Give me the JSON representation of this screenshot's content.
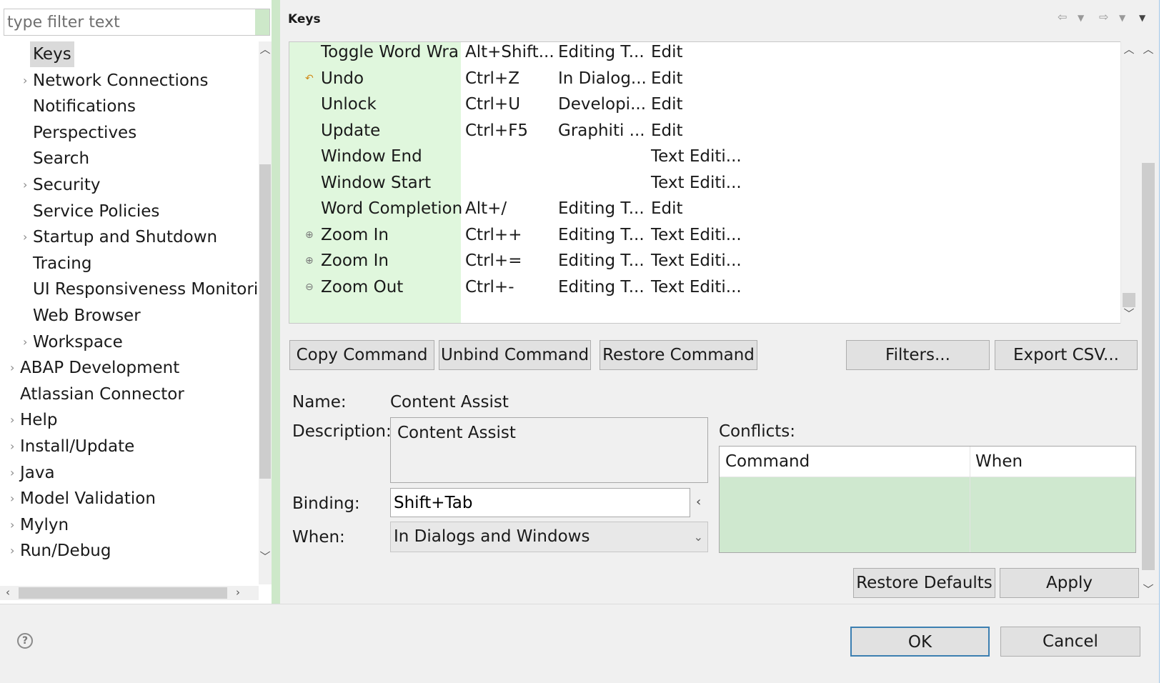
{
  "filter": {
    "placeholder": "type filter text"
  },
  "tree": {
    "items": [
      {
        "label": "Keys",
        "selected": true,
        "expandable": false
      },
      {
        "label": "Network Connections",
        "expandable": true
      },
      {
        "label": "Notifications",
        "expandable": false
      },
      {
        "label": "Perspectives",
        "expandable": false
      },
      {
        "label": "Search",
        "expandable": false
      },
      {
        "label": "Security",
        "expandable": true
      },
      {
        "label": "Service Policies",
        "expandable": false
      },
      {
        "label": "Startup and Shutdown",
        "expandable": true
      },
      {
        "label": "Tracing",
        "expandable": false
      },
      {
        "label": "UI Responsiveness Monitorir",
        "expandable": false
      },
      {
        "label": "Web Browser",
        "expandable": false
      },
      {
        "label": "Workspace",
        "expandable": true
      },
      {
        "label": "ABAP Development",
        "expandable": true
      },
      {
        "label": "Atlassian Connector",
        "expandable": false
      },
      {
        "label": "Help",
        "expandable": true
      },
      {
        "label": "Install/Update",
        "expandable": true
      },
      {
        "label": "Java",
        "expandable": true
      },
      {
        "label": "Model Validation",
        "expandable": true
      },
      {
        "label": "Mylyn",
        "expandable": true
      },
      {
        "label": "Run/Debug",
        "expandable": true
      }
    ]
  },
  "page": {
    "title": "Keys"
  },
  "bindings": {
    "rows": [
      {
        "command": "Toggle Word Wra",
        "binding": "Alt+Shift...",
        "when": "Editing T...",
        "category": "Edit",
        "icon": ""
      },
      {
        "command": "Undo",
        "binding": "Ctrl+Z",
        "when": "In Dialog...",
        "category": "Edit",
        "icon": "undo-icon"
      },
      {
        "command": "Unlock",
        "binding": "Ctrl+U",
        "when": "Developi...",
        "category": "Edit",
        "icon": ""
      },
      {
        "command": "Update",
        "binding": "Ctrl+F5",
        "when": "Graphiti ...",
        "category": "Edit",
        "icon": ""
      },
      {
        "command": "Window End",
        "binding": "",
        "when": "",
        "category": "Text Editi...",
        "icon": ""
      },
      {
        "command": "Window Start",
        "binding": "",
        "when": "",
        "category": "Text Editi...",
        "icon": ""
      },
      {
        "command": "Word Completion",
        "binding": "Alt+/",
        "when": "Editing T...",
        "category": "Edit",
        "icon": ""
      },
      {
        "command": "Zoom In",
        "binding": "Ctrl++",
        "when": "Editing T...",
        "category": "Text Editi...",
        "icon": "zoom-in-icon"
      },
      {
        "command": "Zoom In",
        "binding": "Ctrl+=",
        "when": "Editing T...",
        "category": "Text Editi...",
        "icon": "zoom-in-icon"
      },
      {
        "command": "Zoom Out",
        "binding": "Ctrl+-",
        "when": "Editing T...",
        "category": "Text Editi...",
        "icon": "zoom-out-icon"
      }
    ]
  },
  "actions": {
    "copy": "Copy Command",
    "unbind": "Unbind Command",
    "restore": "Restore Command",
    "filters": "Filters...",
    "export": "Export CSV..."
  },
  "details": {
    "name_label": "Name:",
    "name_value": "Content Assist",
    "description_label": "Description:",
    "description_value": "Content Assist",
    "binding_label": "Binding:",
    "binding_value": "Shift+Tab",
    "when_label": "When:",
    "when_value": "In Dialogs and Windows",
    "conflicts_label": "Conflicts:",
    "conflicts_columns": [
      "Command",
      "When"
    ]
  },
  "footer": {
    "restore_defaults": "Restore Defaults",
    "apply": "Apply",
    "ok": "OK",
    "cancel": "Cancel"
  },
  "colors": {
    "accent_green": "#cde8c9",
    "list_green": "#e0f7dd",
    "ok_border": "#3c7fb1"
  }
}
